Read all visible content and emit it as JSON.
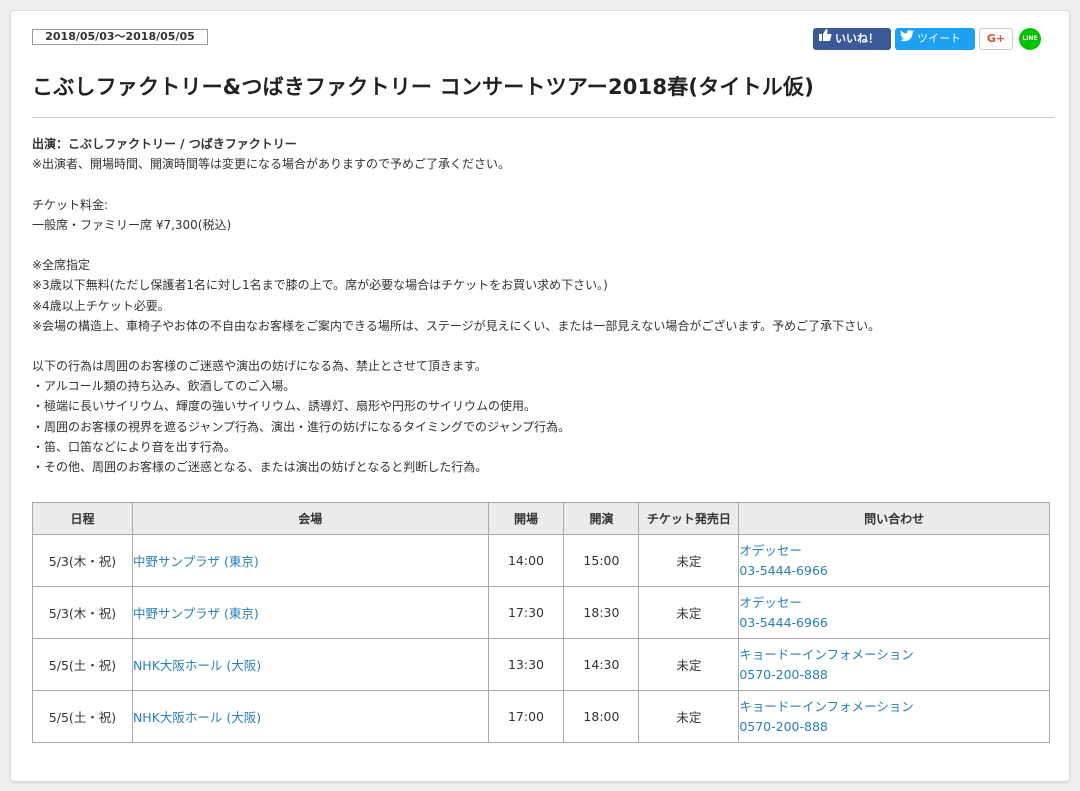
{
  "event": {
    "date_range": "2018/05/03〜2018/05/05",
    "title": "こぶしファクトリー&つばきファクトリー コンサートツアー2018春(タイトル仮)"
  },
  "social": {
    "like_label": "いいね！",
    "tweet_label": "ツイート",
    "gplus_label": "G+",
    "line_label": "LINE",
    "colors": {
      "facebook": "#3b5998",
      "twitter": "#1da1f2",
      "gplus": "#dd4b39",
      "line": "#00c300"
    }
  },
  "details": {
    "performers_line": "出演：こぶしファクトリー / つばきファクトリー",
    "notice_change": "※出演者、開場時間、開演時間等は変更になる場合がありますので予めご了承ください。",
    "ticket_label": "チケット料金:",
    "ticket_price": "一般席・ファミリー席 ¥7,300(税込)",
    "notes": [
      "※全席指定",
      "※3歳以下無料(ただし保護者1名に対し1名まで膝の上で。席が必要な場合はチケットをお買い求め下さい。)",
      "※4歳以上チケット必要。",
      "※会場の構造上、車椅子やお体の不自由なお客様をご案内できる場所は、ステージが見えにくい、または一部見えない場合がございます。予めご了承下さい。"
    ],
    "prohibited_intro": "以下の行為は周囲のお客様のご迷惑や演出の妨げになる為、禁止とさせて頂きます。",
    "prohibited": [
      "・アルコール類の持ち込み、飲酒してのご入場。",
      "・極端に長いサイリウム、輝度の強いサイリウム、誘導灯、扇形や円形のサイリウムの使用。",
      "・周囲のお客様の視界を遮るジャンプ行為、演出・進行の妨げになるタイミングでのジャンプ行為。",
      "・笛、口笛などにより音を出す行為。",
      "・その他、周囲のお客様のご迷惑となる、または演出の妨げとなると判断した行為。"
    ]
  },
  "schedule": {
    "headers": [
      "日程",
      "会場",
      "開場",
      "開演",
      "チケット発売日",
      "問い合わせ"
    ],
    "rows": [
      {
        "date": "5/3(木・祝)",
        "venue": "中野サンプラザ (東京)",
        "open": "14:00",
        "start": "15:00",
        "sale": "未定",
        "contact_name": "オデッセー",
        "contact_tel": "03-5444-6966"
      },
      {
        "date": "5/3(木・祝)",
        "venue": "中野サンプラザ (東京)",
        "open": "17:30",
        "start": "18:30",
        "sale": "未定",
        "contact_name": "オデッセー",
        "contact_tel": "03-5444-6966"
      },
      {
        "date": "5/5(土・祝)",
        "venue": "NHK大阪ホール (大阪)",
        "open": "13:30",
        "start": "14:30",
        "sale": "未定",
        "contact_name": "キョードーインフォメーション",
        "contact_tel": "0570-200-888"
      },
      {
        "date": "5/5(土・祝)",
        "venue": "NHK大阪ホール (大阪)",
        "open": "17:00",
        "start": "18:00",
        "sale": "未定",
        "contact_name": "キョードーインフォメーション",
        "contact_tel": "0570-200-888"
      }
    ]
  }
}
